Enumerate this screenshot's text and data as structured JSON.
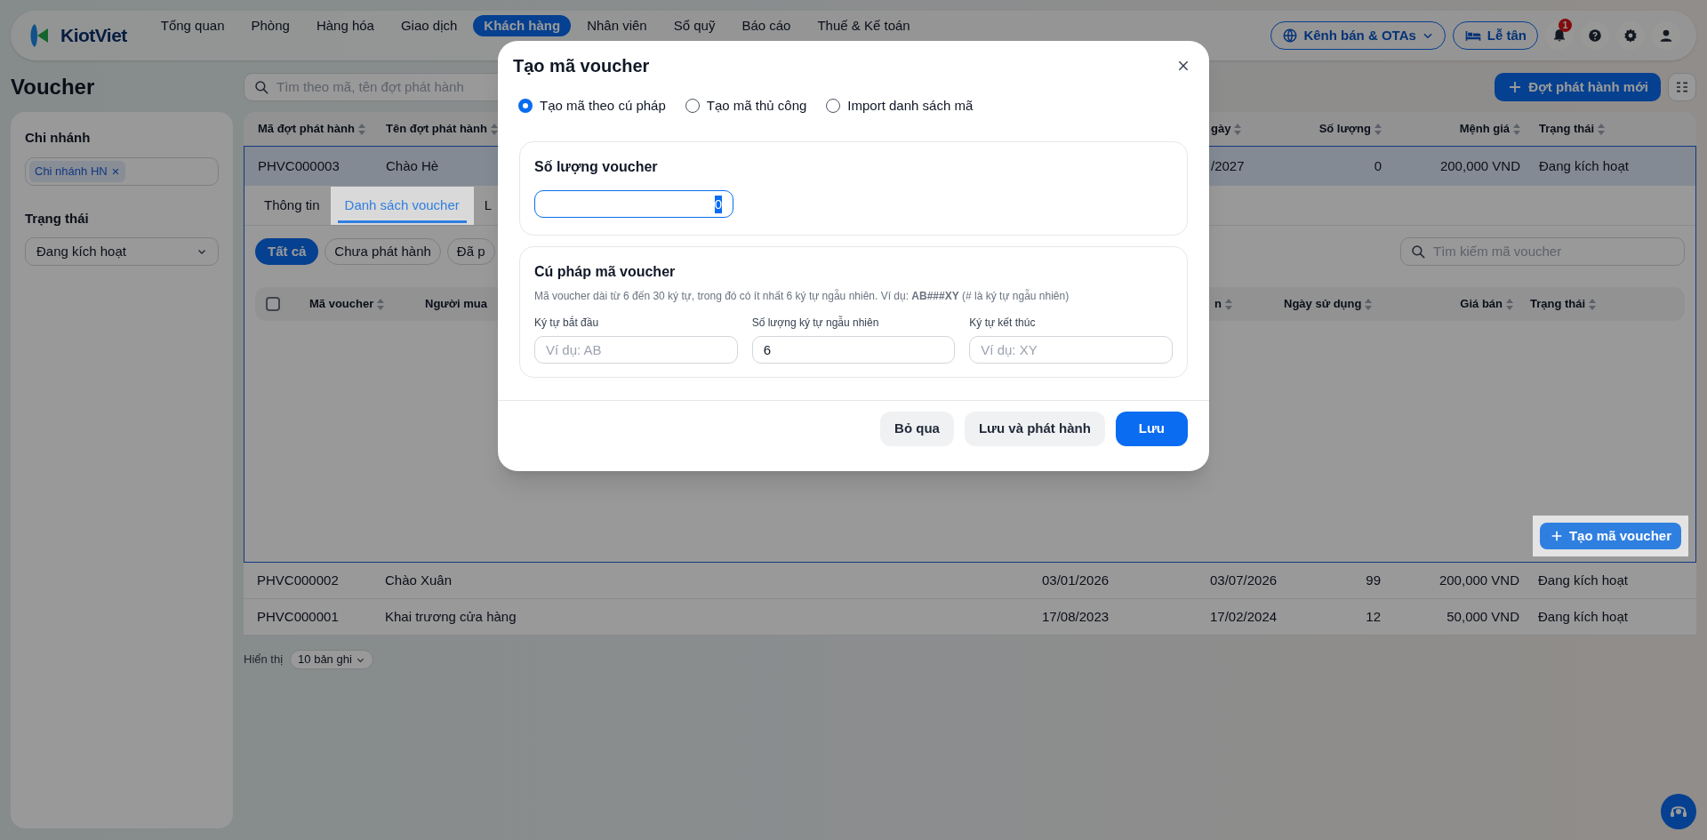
{
  "nav": {
    "logo": "KiotViet",
    "items": [
      {
        "label": "Tổng quan",
        "selected": false
      },
      {
        "label": "Phòng",
        "selected": false
      },
      {
        "label": "Hàng hóa",
        "selected": false
      },
      {
        "label": "Giao dịch",
        "selected": false
      },
      {
        "label": "Khách hàng",
        "selected": true
      },
      {
        "label": "Nhân viên",
        "selected": false
      },
      {
        "label": "Sổ quỹ",
        "selected": false
      },
      {
        "label": "Báo cáo",
        "selected": false
      },
      {
        "label": "Thuế & Kế toán",
        "selected": false
      }
    ],
    "channels": "Kênh bán & OTAs",
    "reception": "Lễ tân",
    "notifications": "1"
  },
  "header": {
    "title": "Voucher",
    "search_placeholder": "Tìm theo mã, tên đợt phát hành",
    "new_button": "Đợt phát hành mới"
  },
  "sidebar": {
    "branch_label": "Chi nhánh",
    "branch_tags": [
      "Chi nhánh HN"
    ],
    "status_label": "Trạng thái",
    "status_value": "Đang kích hoạt"
  },
  "table": {
    "columns": {
      "code": "Mã đợt phát hành",
      "name": "Tên đợt phát hành",
      "end": "gày",
      "quantity": "Số lượng",
      "value": "Mệnh giá",
      "status": "Trạng thái"
    },
    "rows": [
      {
        "code": "PHVC000003",
        "name": "Chào Hè",
        "end": "/2027",
        "quantity": "0",
        "value": "200,000 VND",
        "status": "Đang kích hoạt",
        "expanded": true
      },
      {
        "code": "PHVC000002",
        "name": "Chào Xuân",
        "start": "03/01/2026",
        "end": "03/07/2026",
        "quantity": "99",
        "value": "200,000 VND",
        "status": "Đang kích hoạt",
        "expanded": false
      },
      {
        "code": "PHVC000001",
        "name": "Khai trương cửa hàng",
        "start": "17/08/2023",
        "end": "17/02/2024",
        "quantity": "12",
        "value": "50,000 VND",
        "status": "Đang kích hoạt",
        "expanded": false
      }
    ]
  },
  "detail": {
    "tabs": [
      {
        "label": "Thông tin",
        "selected": false
      },
      {
        "label": "Danh sách voucher",
        "selected": true
      },
      {
        "label": "L",
        "selected": false
      }
    ],
    "chips": [
      {
        "label": "Tất cả",
        "selected": true
      },
      {
        "label": "Chưa phát hành",
        "selected": false
      },
      {
        "label": "Đã p",
        "selected": false
      }
    ],
    "search_placeholder": "Tìm kiếm mã voucher",
    "select_all": {
      "checked": false
    },
    "columns_left": [
      "Mã voucher",
      "Người mua"
    ],
    "columns_right": [
      "n",
      "Ngày sử dụng",
      "Giá bán",
      "Trạng thái"
    ],
    "create_button": "Tạo mã voucher"
  },
  "pagination": {
    "label": "Hiển thị",
    "page_size": "10 bản ghi"
  },
  "modal": {
    "title": "Tạo mã voucher",
    "modes": [
      {
        "label": "Tạo mã theo cú pháp",
        "selected": true
      },
      {
        "label": "Tạo mã thủ công",
        "selected": false
      },
      {
        "label": "Import danh sách mã",
        "selected": false
      }
    ],
    "quantity": {
      "title": "Số lượng voucher",
      "value": "0"
    },
    "syntax": {
      "title": "Cú pháp mã voucher",
      "hint": "Mã voucher dài từ 6 đến 30 ký tự, trong đó có ít nhất 6 ký tự ngẫu nhiên. Ví dụ: **AB###XY** (# là ký tự ngẫu nhiên)",
      "fields": [
        {
          "label": "Ký tự bắt đầu",
          "placeholder": "Ví dụ: AB"
        },
        {
          "label": "Số lượng ký tự ngẫu nhiên",
          "value": "6"
        },
        {
          "label": "Ký tự kết thúc",
          "placeholder": "Ví dụ: XY"
        }
      ]
    },
    "buttons": [
      {
        "label": "Bỏ qua",
        "kind": "secondary"
      },
      {
        "label": "Lưu và phát hành",
        "kind": "secondary"
      },
      {
        "label": "Lưu",
        "kind": "primary"
      }
    ]
  }
}
